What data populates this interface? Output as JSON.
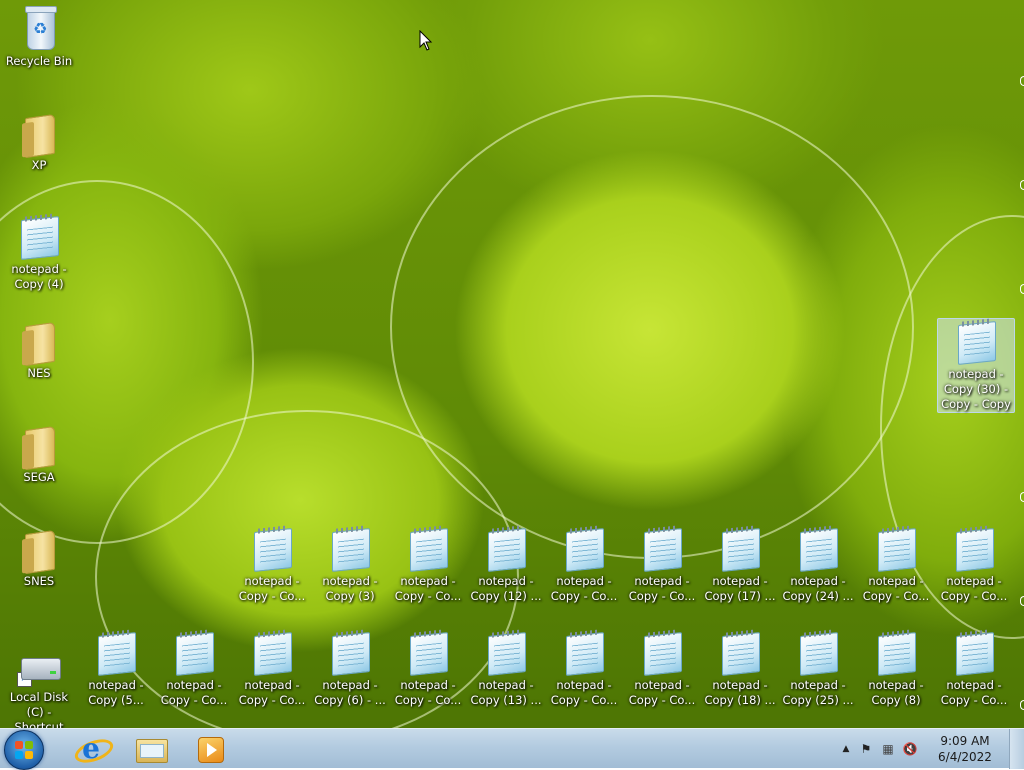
{
  "desktop": {
    "left_column": [
      {
        "id": "recycle-bin",
        "type": "bin",
        "label": "Recycle Bin"
      },
      {
        "id": "xp",
        "type": "folder",
        "label": "XP"
      },
      {
        "id": "notepad-copy-4",
        "type": "notepad",
        "label": "notepad - Copy (4)"
      },
      {
        "id": "nes",
        "type": "folder",
        "label": "NES"
      },
      {
        "id": "sega",
        "type": "folder",
        "label": "SEGA"
      },
      {
        "id": "snes",
        "type": "folder",
        "label": "SNES"
      },
      {
        "id": "local-disk",
        "type": "drive",
        "label": "Local Disk (C) - Shortcut"
      }
    ],
    "selected_icon": {
      "label": "notepad - Copy (30) - Copy - Copy"
    },
    "row_upper": [
      "notepad - Copy - Co...",
      "notepad - Copy (3)",
      "notepad - Copy - Co...",
      "notepad - Copy (12) ...",
      "notepad - Copy - Co...",
      "notepad - Copy - Co...",
      "notepad - Copy (17) ...",
      "notepad - Copy (24) ...",
      "notepad - Copy - Co...",
      "notepad - Copy - Co..."
    ],
    "row_lower": [
      "notepad - Copy (5...",
      "notepad - Copy - Co...",
      "notepad - Copy - Co...",
      "notepad - Copy (6) - ...",
      "notepad - Copy - Co...",
      "notepad - Copy (13) ...",
      "notepad - Copy - Co...",
      "notepad - Copy - Co...",
      "notepad - Copy (18) ...",
      "notepad - Copy (25) ...",
      "notepad - Copy (8)",
      "notepad - Copy - Co..."
    ]
  },
  "taskbar": {
    "pinned": [
      {
        "name": "internet-explorer",
        "icon": "ie-icon"
      },
      {
        "name": "windows-explorer",
        "icon": "folder-explorer-icon"
      },
      {
        "name": "windows-media-player",
        "icon": "media-player-icon"
      }
    ],
    "tray": {
      "show_hidden_glyph": "▲",
      "action_center_glyph": "⚑",
      "network_glyph": "▦",
      "volume_glyph": "🔇",
      "time": "9:09 AM",
      "date": "6/4/2022"
    }
  },
  "colors": {
    "taskbar": "#b3cbe0",
    "selection": "#d2e6fa"
  }
}
